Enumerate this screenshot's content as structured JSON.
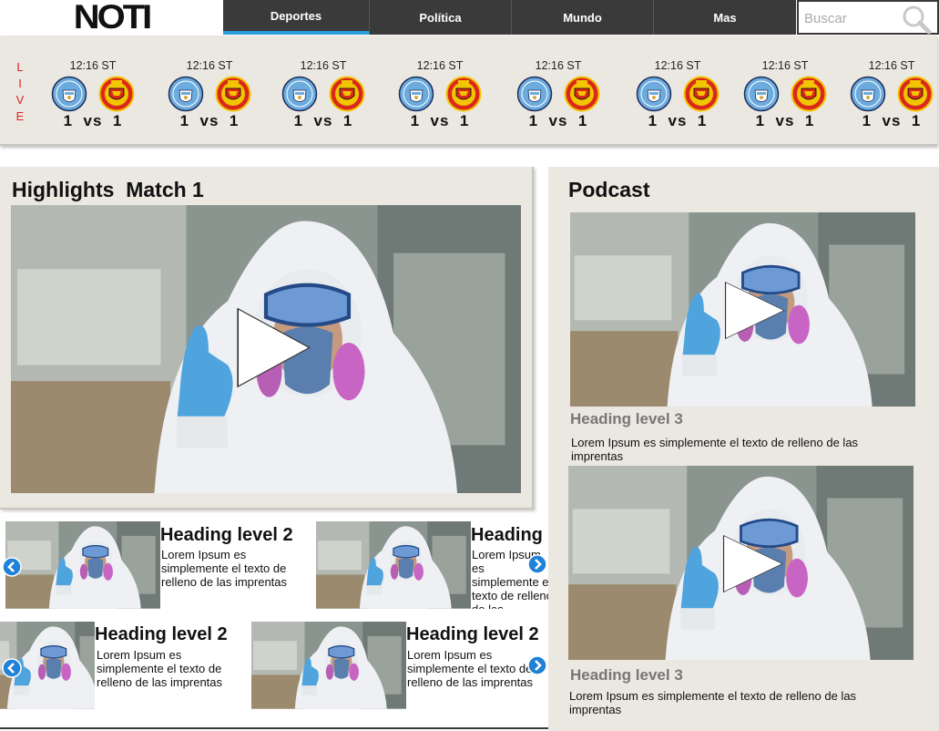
{
  "header": {
    "logo": "NOTI",
    "nav": [
      {
        "label": "Deportes",
        "active": true
      },
      {
        "label": "Política",
        "active": false
      },
      {
        "label": "Mundo",
        "active": false
      },
      {
        "label": "Mas",
        "active": false
      }
    ],
    "search_placeholder": "Buscar",
    "search_icon": "magnifier-icon"
  },
  "live": {
    "letters": [
      "L",
      "I",
      "V",
      "E"
    ],
    "color": "#dd2222",
    "matches": [
      {
        "time": "12:16 ST",
        "home_goals": "1",
        "vs": "vs",
        "away_goals": "1",
        "home_crest": "manchester-city-crest",
        "away_crest": "manchester-united-crest"
      },
      {
        "time": "12:16 ST",
        "home_goals": "1",
        "vs": "vs",
        "away_goals": "1",
        "home_crest": "manchester-city-crest",
        "away_crest": "manchester-united-crest"
      },
      {
        "time": "12:16 ST",
        "home_goals": "1",
        "vs": "vs",
        "away_goals": "1",
        "home_crest": "manchester-city-crest",
        "away_crest": "manchester-united-crest"
      },
      {
        "time": "12:16 ST",
        "home_goals": "1",
        "vs": "vs",
        "away_goals": "1",
        "home_crest": "manchester-city-crest",
        "away_crest": "manchester-united-crest"
      },
      {
        "time": "12:16 ST",
        "home_goals": "1",
        "vs": "vs",
        "away_goals": "1",
        "home_crest": "manchester-city-crest",
        "away_crest": "manchester-united-crest"
      },
      {
        "time": "12:16 ST",
        "home_goals": "1",
        "vs": "vs",
        "away_goals": "1",
        "home_crest": "manchester-city-crest",
        "away_crest": "manchester-united-crest"
      },
      {
        "time": "12:16 ST",
        "home_goals": "1",
        "vs": "vs",
        "away_goals": "1",
        "home_crest": "manchester-city-crest",
        "away_crest": "manchester-united-crest"
      },
      {
        "time": "12:16 ST",
        "home_goals": "1",
        "vs": "vs",
        "away_goals": "1",
        "home_crest": "manchester-city-crest",
        "away_crest": "manchester-united-crest"
      }
    ]
  },
  "highlights": {
    "title": "Highlights  Match 1",
    "video_icon": "play-icon"
  },
  "cards": [
    {
      "heading": "Heading level 2",
      "text": "Lorem Ipsum es simplemente el texto de relleno de las imprentas"
    },
    {
      "heading": "Heading",
      "text": "Lorem Ipsum es simplemente el texto de relleno de las imprentas"
    },
    {
      "heading": "Heading level 2",
      "text": "Lorem Ipsum es simplemente el texto de relleno de las imprentas"
    },
    {
      "heading": "Heading level 2",
      "text": "Lorem Ipsum es simplemente el texto de relleno de las imprentas"
    }
  ],
  "carousel_icons": {
    "prev": "arrow-left-icon",
    "next": "arrow-right-icon",
    "color": "#1f82d6"
  },
  "podcast": {
    "title": "Podcast",
    "items": [
      {
        "heading": "Heading level 3",
        "text": "Lorem Ipsum es simplemente el texto de relleno de las imprentas"
      },
      {
        "heading": "Heading level 3",
        "text": "Lorem Ipsum es simplemente el texto de relleno de las imprentas"
      }
    ]
  },
  "colors": {
    "nav_bg": "#3a3a3a",
    "nav_active_underline": "#2a9fd8",
    "panel_bg": "#ebe8e2",
    "live_text": "#dd2222",
    "heading3": "#777777"
  }
}
